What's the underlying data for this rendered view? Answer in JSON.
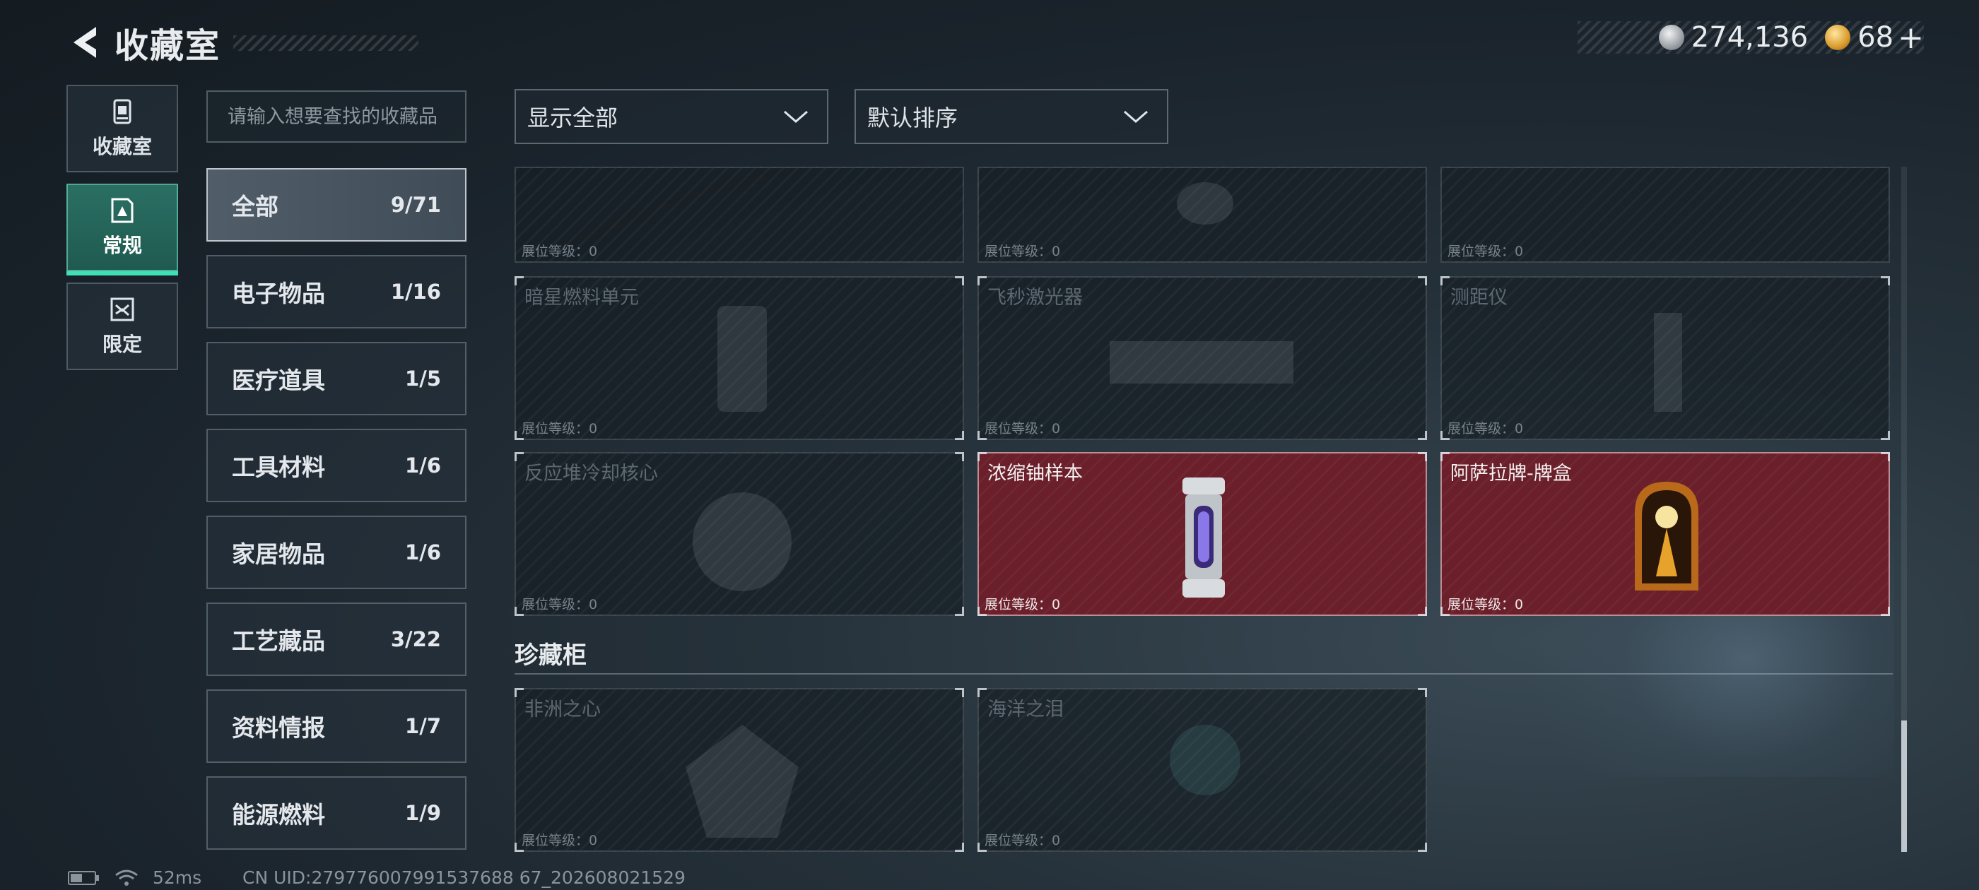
{
  "header": {
    "title": "收藏室"
  },
  "currency": {
    "silver_value": "274,136",
    "gold_value": "68",
    "plus": "+"
  },
  "modes": [
    {
      "label": "收藏室",
      "icon": "collection-icon",
      "active": false
    },
    {
      "label": "常规",
      "icon": "regular-icon",
      "active": true
    },
    {
      "label": "限定",
      "icon": "limited-icon",
      "active": false
    }
  ],
  "search": {
    "placeholder": "请输入想要查找的收藏品"
  },
  "categories": [
    {
      "name": "全部",
      "count": "9/71",
      "active": true
    },
    {
      "name": "电子物品",
      "count": "1/16"
    },
    {
      "name": "医疗道具",
      "count": "1/5"
    },
    {
      "name": "工具材料",
      "count": "1/6"
    },
    {
      "name": "家居物品",
      "count": "1/6"
    },
    {
      "name": "工艺藏品",
      "count": "3/22"
    },
    {
      "name": "资料情报",
      "count": "1/7"
    },
    {
      "name": "能源燃料",
      "count": "1/9"
    }
  ],
  "filters": {
    "display": "显示全部",
    "sort": "默认排序"
  },
  "items": [
    {
      "name": "",
      "level": "展位等级：0",
      "owned": false
    },
    {
      "name": "",
      "level": "展位等级：0",
      "owned": false
    },
    {
      "name": "",
      "level": "展位等级：0",
      "owned": false
    },
    {
      "name": "暗星燃料单元",
      "level": "展位等级：0",
      "owned": false
    },
    {
      "name": "飞秒激光器",
      "level": "展位等级：0",
      "owned": false
    },
    {
      "name": "测距仪",
      "level": "展位等级：0",
      "owned": false
    },
    {
      "name": "反应堆冷却核心",
      "level": "展位等级：0",
      "owned": false
    },
    {
      "name": "浓缩铀样本",
      "level": "展位等级：0",
      "owned": true
    },
    {
      "name": "阿萨拉牌-牌盒",
      "level": "展位等级：0",
      "owned": true
    }
  ],
  "cabinet": {
    "title": "珍藏柜",
    "items": [
      {
        "name": "非洲之心",
        "level": "展位等级：0",
        "owned": false
      },
      {
        "name": "海洋之泪",
        "level": "展位等级：0",
        "owned": false
      }
    ]
  },
  "status": {
    "ping": "52ms",
    "uid": "CN UID:279776007991537688 67_202608021529"
  },
  "colors": {
    "accent": "#3fe0b4",
    "owned_card": "#6a1f2a",
    "background": "#1a232b"
  }
}
